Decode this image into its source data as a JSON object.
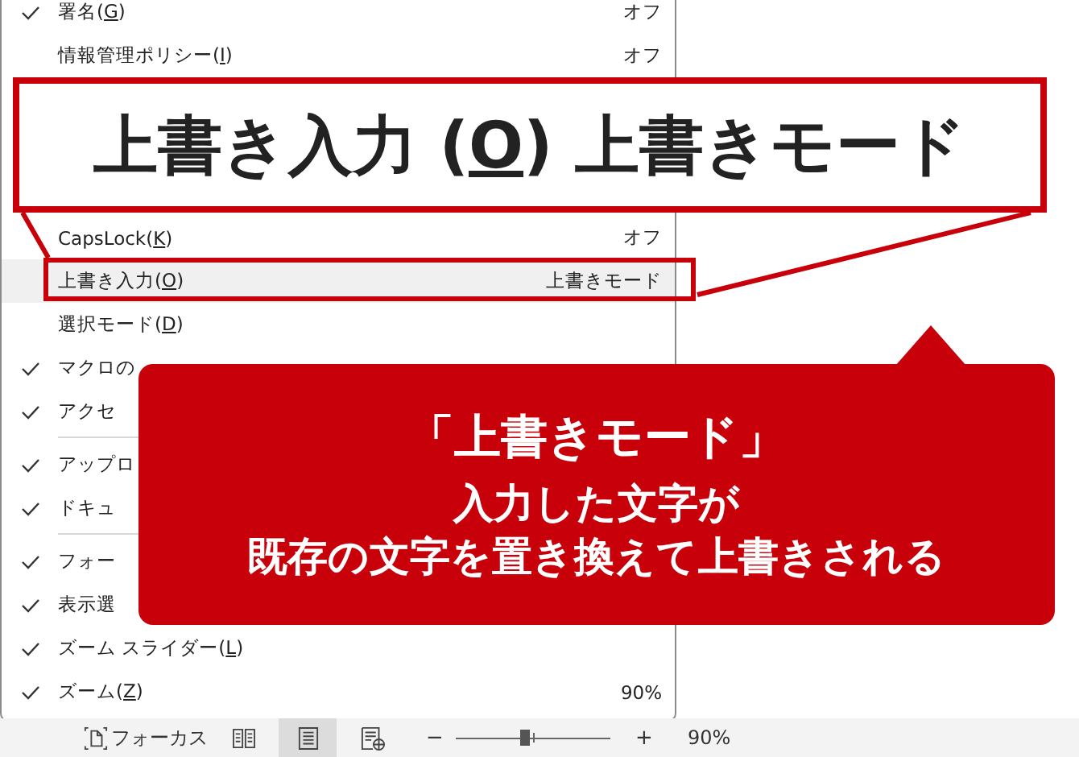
{
  "menu": {
    "items": [
      {
        "kind": "item",
        "text": "署名(",
        "access_key": "G",
        "text_after": ")",
        "checked": true,
        "value": "オフ",
        "highlighted": false
      },
      {
        "kind": "item",
        "text": "情報管理ポリシー(",
        "access_key": "I",
        "text_after": ")",
        "checked": false,
        "value": "オフ",
        "highlighted": false
      },
      {
        "kind": "gap"
      },
      {
        "kind": "item",
        "text": "CapsLock(",
        "access_key": "K",
        "text_after": ")",
        "checked": false,
        "value": "オフ",
        "highlighted": false
      },
      {
        "kind": "item",
        "text": "上書き入力(",
        "access_key": "O",
        "text_after": ")",
        "checked": false,
        "value": "上書きモード",
        "highlighted": true
      },
      {
        "kind": "item",
        "text": "選択モード(",
        "access_key": "D",
        "text_after": ")",
        "checked": false,
        "highlighted": false
      },
      {
        "kind": "item",
        "text": "マクロの",
        "checked": true,
        "highlighted": false
      },
      {
        "kind": "item",
        "text": "アクセ",
        "checked": true,
        "highlighted": false
      },
      {
        "kind": "separator"
      },
      {
        "kind": "item",
        "text": "アップロ",
        "checked": true,
        "highlighted": false
      },
      {
        "kind": "item",
        "text": "ドキュ",
        "checked": true,
        "highlighted": false
      },
      {
        "kind": "separator"
      },
      {
        "kind": "item",
        "text": "フォー",
        "checked": true,
        "highlighted": false
      },
      {
        "kind": "item",
        "text": "表示選",
        "checked": true,
        "highlighted": false
      },
      {
        "kind": "item",
        "text": "ズーム スライダー(",
        "access_key": "L",
        "text_after": ")",
        "checked": true,
        "highlighted": false
      },
      {
        "kind": "item",
        "text": "ズーム(",
        "access_key": "Z",
        "text_after": ")",
        "checked": true,
        "value": "90%",
        "highlighted": false
      }
    ]
  },
  "zoom_callout": {
    "text": "上書き入力 (",
    "access_key": "O",
    "text_after": ") 上書きモード"
  },
  "explanation_callout": {
    "title": "「上書きモード」",
    "lines": [
      "入力した文字が",
      "既存の文字を置き換えて上書きされる"
    ]
  },
  "status_bar": {
    "focus_label": "フォーカス",
    "views": [
      {
        "kind": "read",
        "selected": false
      },
      {
        "kind": "print",
        "selected": true
      },
      {
        "kind": "web",
        "selected": false
      }
    ],
    "zoom_minus": "−",
    "zoom_plus": "+",
    "zoom": {
      "level": 0.45
    },
    "zoom_value": "90%"
  }
}
